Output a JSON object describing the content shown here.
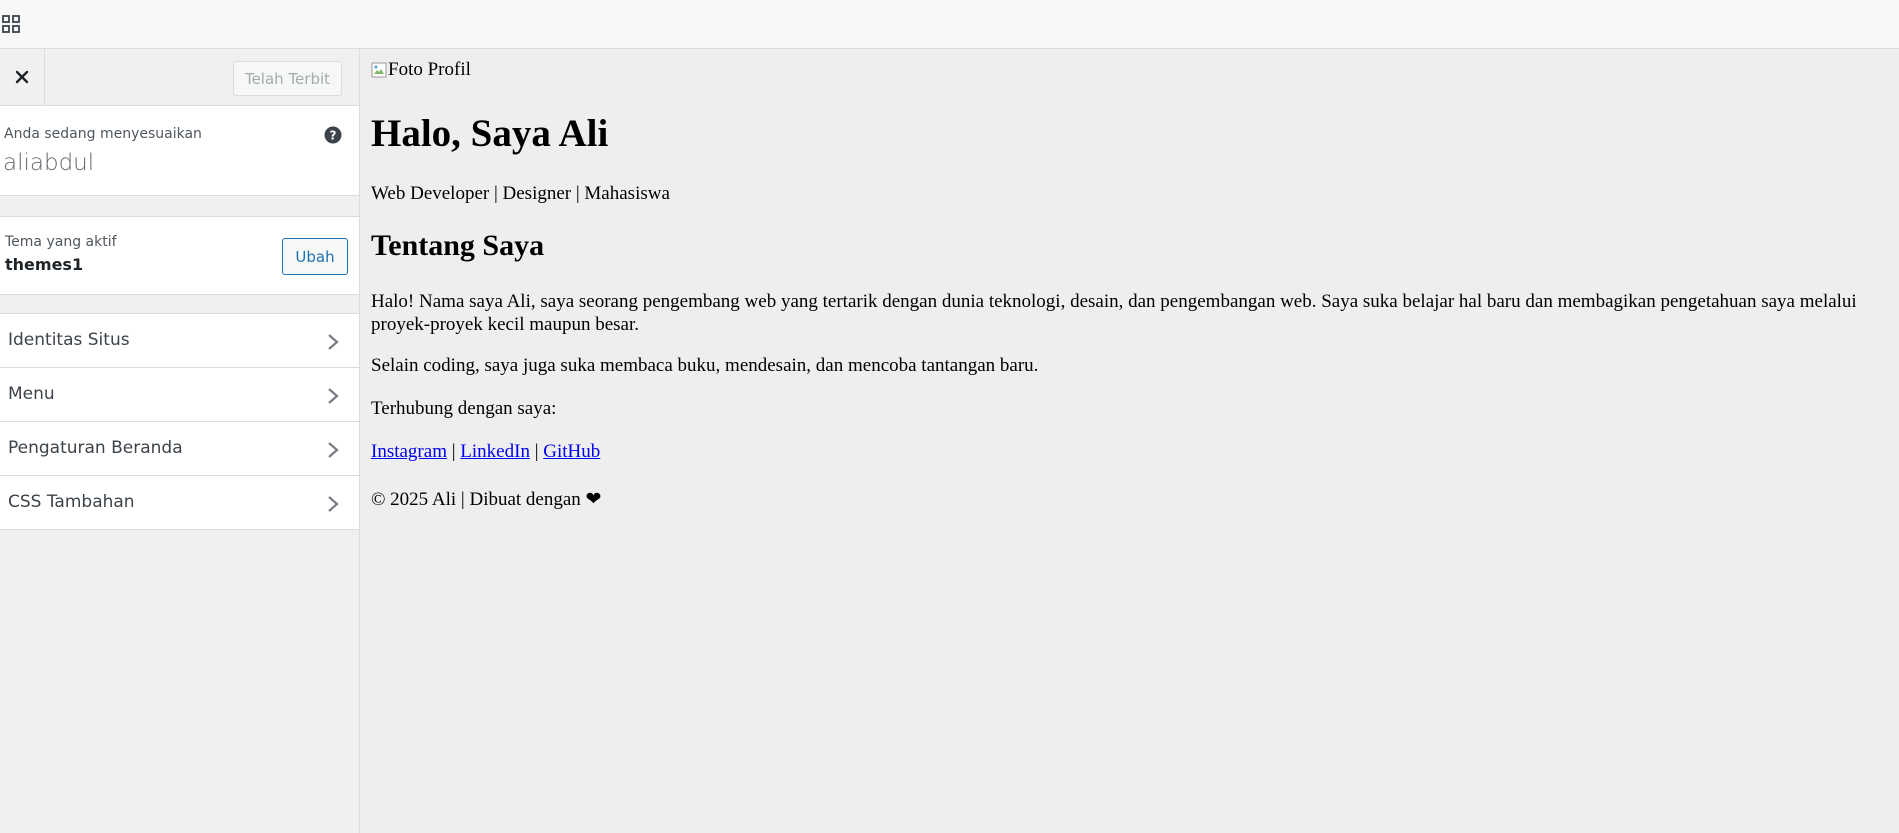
{
  "topbar": {
    "apps_icon": "grid-apps-icon"
  },
  "sidebar": {
    "close_icon": "close-icon",
    "publish_label": "Telah Terbit",
    "info": {
      "label": "Anda sedang menyesuaikan",
      "site_name": "aliabdul",
      "help_icon": "help-icon"
    },
    "theme": {
      "label": "Tema yang aktif",
      "name": "themes1",
      "change_label": "Ubah"
    },
    "sections": [
      {
        "label": "Identitas Situs"
      },
      {
        "label": "Menu"
      },
      {
        "label": "Pengaturan Beranda"
      },
      {
        "label": "CSS Tambahan"
      }
    ]
  },
  "preview": {
    "photo_alt": "Foto Profil",
    "hero_title": "Halo, Saya Ali",
    "tagline": "Web Developer | Designer | Mahasiswa",
    "about_title": "Tentang Saya",
    "about_text_1": "Halo! Nama saya Ali, saya seorang pengembang web yang tertarik dengan dunia teknologi, desain, dan pengembangan web. Saya suka belajar hal baru dan membagikan pengetahuan saya melalui proyek-proyek kecil maupun besar.",
    "about_text_2": "Selain coding, saya juga suka membaca buku, mendesain, dan mencoba tantangan baru.",
    "connect_text": "Terhubung dengan saya:",
    "links": {
      "instagram": "Instagram",
      "linkedin": "LinkedIn",
      "github": "GitHub",
      "separator": " | "
    },
    "footer": "© 2025 Ali | Dibuat dengan ❤"
  },
  "colors": {
    "accent": "#2271b1",
    "sidebar_bg": "#f0f0f1",
    "preview_bg": "#eeeeee",
    "link": "#0000ee"
  }
}
